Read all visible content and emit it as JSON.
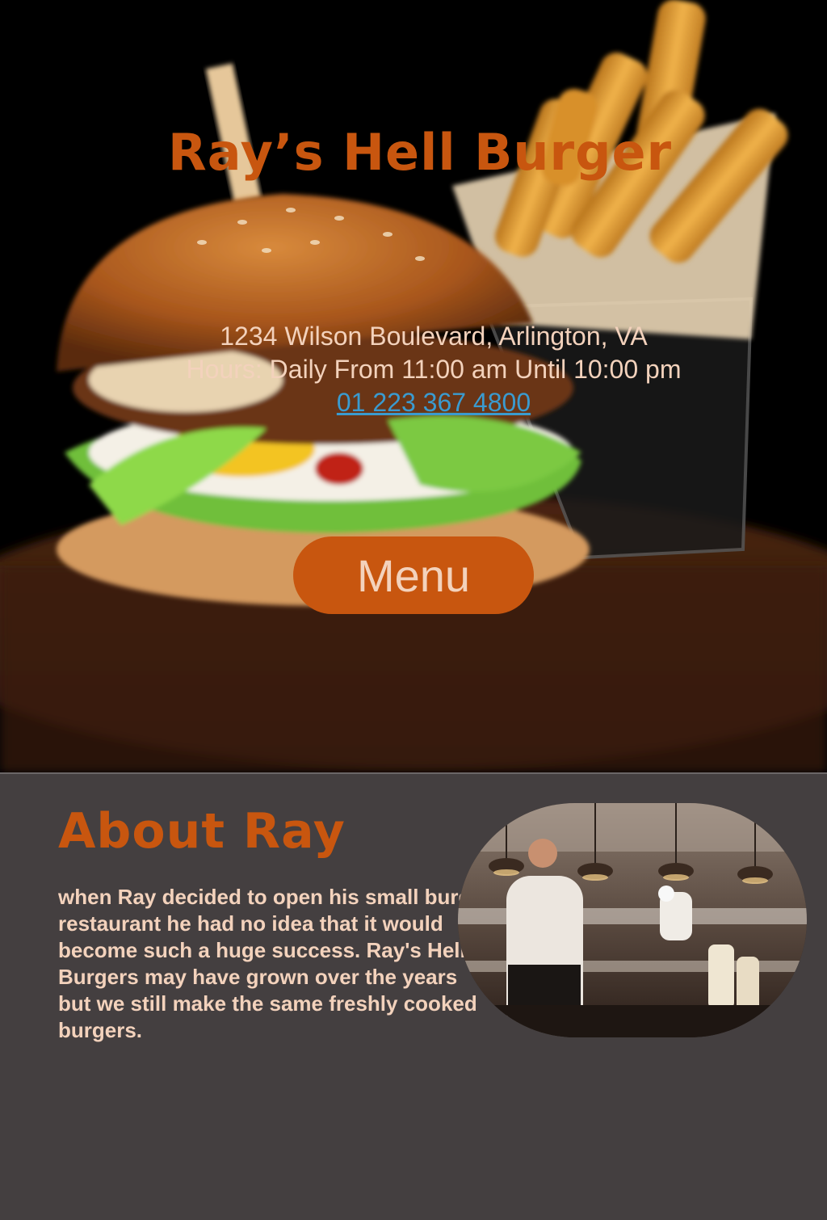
{
  "hero": {
    "title": "Ray’s Hell Burger",
    "address": "1234 Wilson Boulevard, Arlington, VA",
    "hours": "Hours: Daily From 11:00 am Until 10:00 pm",
    "phone": "01 223 367 4800",
    "menu_label": "Menu"
  },
  "about": {
    "title": "About Ray",
    "body": "when Ray decided to open his small burger restaurant he had no idea that it would become such a huge success. Ray's Hell Burgers may have grown over the years but we still make the same freshly cooked burgers."
  },
  "colors": {
    "accent": "#c8560f",
    "text_light": "#f3d2bc",
    "link": "#3a9bd0",
    "section_bg": "#443f40"
  }
}
